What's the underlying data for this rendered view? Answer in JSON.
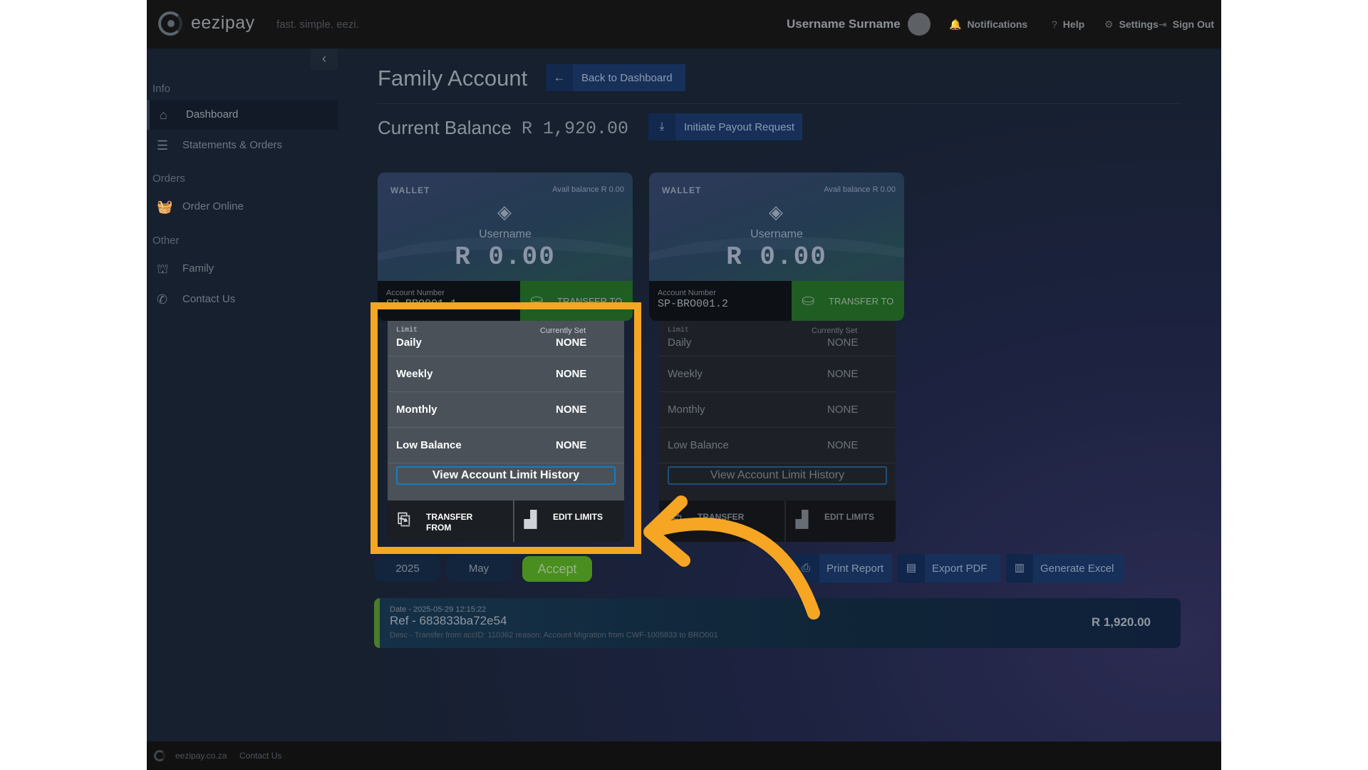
{
  "app": {
    "brand": "eezipay",
    "tagline": "fast. simple. eezi.",
    "accent_color": "#f6a623"
  },
  "topbar": {
    "username": "Username Surname",
    "notifications": {
      "label": "Notifications",
      "icon": "bell-icon"
    },
    "help": {
      "label": "Help",
      "icon": "question-icon"
    },
    "settings": {
      "label": "Settings",
      "icon": "gear-icon"
    },
    "signout": {
      "label": "Sign Out",
      "icon": "sign-out-icon"
    }
  },
  "sidebar": {
    "sections": [
      {
        "label": "Info"
      },
      {
        "label": "Orders"
      },
      {
        "label": "Other"
      }
    ],
    "items": [
      {
        "label": "Dashboard",
        "icon": "home-icon",
        "active": true
      },
      {
        "label": "Statements & Orders",
        "icon": "list-icon"
      },
      {
        "label": "Order Online",
        "icon": "basket-icon"
      },
      {
        "label": "Family",
        "icon": "family-icon"
      },
      {
        "label": "Contact Us",
        "icon": "phone-icon"
      }
    ]
  },
  "header": {
    "title": "Family Account",
    "back_label": "Back to Dashboard",
    "balance_label": "Current Balance",
    "balance_value": "R 1,920.00",
    "payout_label": "Initiate Payout Request"
  },
  "wallets": [
    {
      "label": "WALLET",
      "avail": "Avail balance R 0.00",
      "user": "Username",
      "amount": "R 0.00",
      "account_label": "Account Number",
      "account_number": "SP-BRO001.1",
      "transfer_label": "TRANSFER TO",
      "limits": {
        "limit_label": "Limit",
        "set_label": "Currently Set",
        "rows": [
          {
            "name": "Daily",
            "value": "NONE"
          },
          {
            "name": "Weekly",
            "value": "NONE"
          },
          {
            "name": "Monthly",
            "value": "NONE"
          },
          {
            "name": "Low Balance",
            "value": "NONE"
          }
        ],
        "history_label": "View Account Limit History",
        "transfer_from_label": "TRANSFER FROM",
        "edit_limits_label": "EDIT LIMITS"
      }
    },
    {
      "label": "WALLET",
      "avail": "Avail balance R 0.00",
      "user": "Username",
      "amount": "R 0.00",
      "account_label": "Account Number",
      "account_number": "SP-BRO001.2",
      "transfer_label": "TRANSFER TO",
      "limits": {
        "limit_label": "Limit",
        "set_label": "Currently Set",
        "rows": [
          {
            "name": "Daily",
            "value": "NONE"
          },
          {
            "name": "Weekly",
            "value": "NONE"
          },
          {
            "name": "Monthly",
            "value": "NONE"
          },
          {
            "name": "Low Balance",
            "value": "NONE"
          }
        ],
        "history_label": "View Account Limit History",
        "transfer_from_label": "TRANSFER FROM",
        "edit_limits_label": "EDIT LIMITS"
      }
    }
  ],
  "filters": {
    "year": "2025",
    "month": "May",
    "accept_label": "Accept"
  },
  "reports": {
    "print_label": "Print Report",
    "pdf_label": "Export PDF",
    "excel_label": "Generate Excel"
  },
  "transactions": [
    {
      "date": "Date - 2025-05-29 12:15:22",
      "ref": "Ref - 683833ba72e54",
      "desc": "Desc - Transfer from accID: 110362 reason: Account Migration from CWF-1005833 to BRO001",
      "amount": "R 1,920.00"
    }
  ],
  "footer": {
    "site": "eezipay.co.za",
    "contact": "Contact Us"
  }
}
